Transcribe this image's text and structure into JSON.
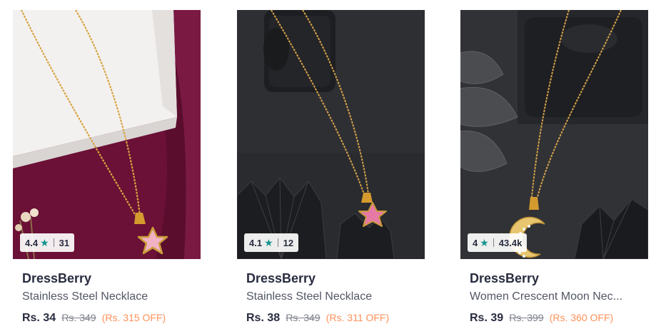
{
  "products": [
    {
      "brand": "DressBerry",
      "title": "Stainless Steel Necklace",
      "rating": "4.4",
      "rating_count": "31",
      "price": "Rs. 34",
      "mrp": "Rs. 349",
      "discount": "(Rs. 315 OFF)"
    },
    {
      "brand": "DressBerry",
      "title": "Stainless Steel Necklace",
      "rating": "4.1",
      "rating_count": "12",
      "price": "Rs. 38",
      "mrp": "Rs. 349",
      "discount": "(Rs. 311 OFF)"
    },
    {
      "brand": "DressBerry",
      "title": "Women Crescent Moon Nec...",
      "rating": "4",
      "rating_count": "43.4k",
      "price": "Rs. 39",
      "mrp": "Rs. 399",
      "discount": "(Rs. 360 OFF)"
    }
  ],
  "icons": {
    "rating": "star-icon"
  },
  "colors": {
    "star": "#14958f",
    "discount": "#ff905a",
    "brand_text": "#282c3f",
    "title_text": "#535766"
  }
}
